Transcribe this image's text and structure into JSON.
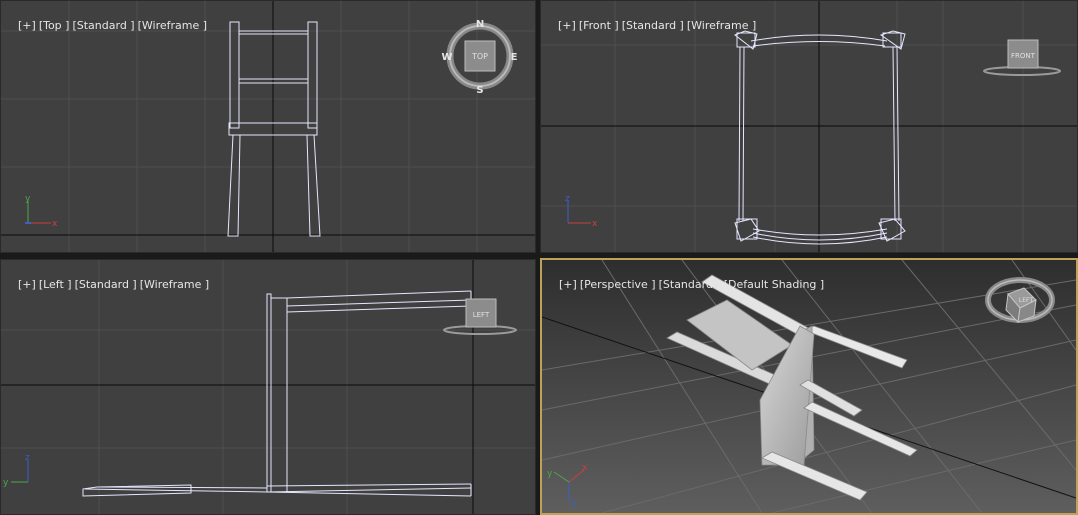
{
  "colors": {
    "viewport_bg": "#404040",
    "grid": "#4e4e4e",
    "axis_line": "#0a0a0a",
    "wire": "#e6e6ff",
    "active_border": "#bfa25a"
  },
  "viewports": {
    "top": {
      "label_plus": "[+]",
      "label_view": "[Top ]",
      "label_mode": "[Standard ]",
      "label_shading": "[Wireframe ]"
    },
    "front": {
      "label_plus": "[+]",
      "label_view": "[Front ]",
      "label_mode": "[Standard ]",
      "label_shading": "[Wireframe ]"
    },
    "left": {
      "label_plus": "[+]",
      "label_view": "[Left ]",
      "label_mode": "[Standard ]",
      "label_shading": "[Wireframe ]"
    },
    "perspective": {
      "label_plus": "[+]",
      "label_view": "[Perspective ]",
      "label_mode": "[Standard ]",
      "label_shading": "[Default Shading ]",
      "active": true
    }
  },
  "viewcube": {
    "top": {
      "face": "TOP",
      "n": "N",
      "s": "S",
      "e": "E",
      "w": "W"
    },
    "front": {
      "face": "FRONT"
    },
    "left": {
      "face": "LEFT"
    },
    "perspective": {
      "face": "LEFT"
    }
  },
  "axis_tripod": {
    "x": "x",
    "y": "y",
    "z": "z"
  }
}
